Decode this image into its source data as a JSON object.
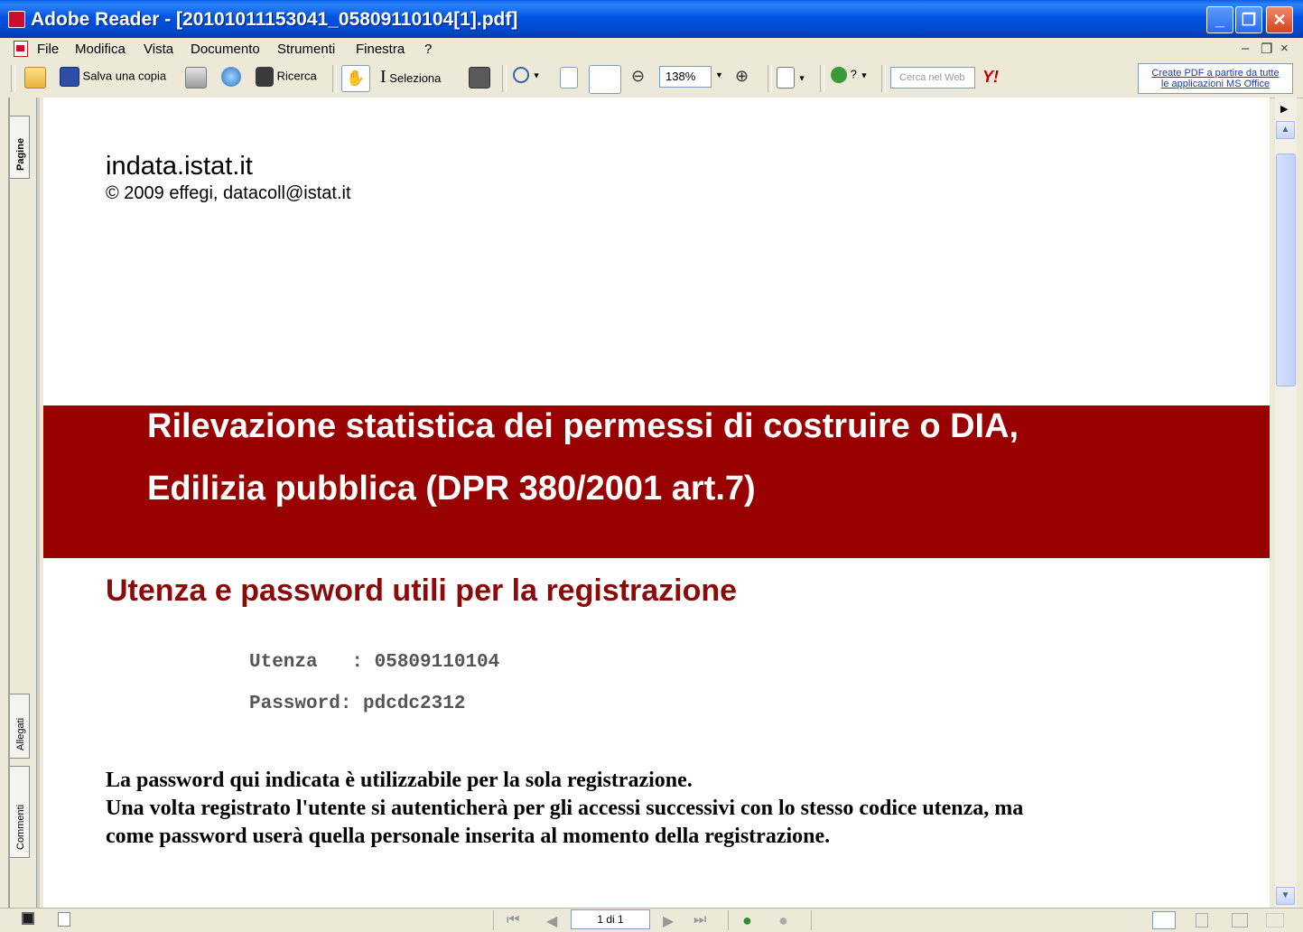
{
  "window": {
    "title": "Adobe Reader - [20101011153041_05809110104[1].pdf]",
    "controls": {
      "minimize": "_",
      "restore": "❐",
      "close": "✕"
    }
  },
  "menu": {
    "items": [
      "File",
      "Modifica",
      "Vista",
      "Documento",
      "Strumenti",
      "Finestra",
      "?"
    ],
    "mdi_controls": [
      "–",
      "❐",
      "×"
    ]
  },
  "toolbar": {
    "save_copy": "Salva una copia",
    "search": "Ricerca",
    "select": "Seleziona",
    "zoom": "138%",
    "help": "?",
    "web_search_placeholder": "Cerca nel Web",
    "yahoo": "Y!",
    "create_pdf_line1": "Create PDF a partire da tutte",
    "create_pdf_line2": "le applicazioni MS Office"
  },
  "side_tabs": {
    "pages": "Pagine",
    "attachments": "Allegati",
    "comments": "Commenti"
  },
  "document": {
    "site": "indata.istat.it",
    "copyright": "© 2009 effegi, datacoll@istat.it",
    "banner_line1": "Rilevazione statistica dei permessi di costruire o DIA,",
    "banner_line2": "Edilizia pubblica (DPR 380/2001 art.7)",
    "subheading": "Utenza e password utili per la registrazione",
    "user_line": "Utenza   : 05809110104",
    "password_line": "Password: pdcdc2312",
    "note_line1": "La password qui indicata è utilizzabile per la sola registrazione.",
    "note_line2": "Una volta registrato l'utente si autenticherà per gli accessi successivi con lo stesso codice utenza, ma",
    "note_line3": "come password userà quella personale inserita al momento della registrazione."
  },
  "status": {
    "page_indicator": "1 di 1"
  },
  "colors": {
    "banner": "#990000",
    "subheading": "#8B0A0A",
    "titlebar": "#0054E3"
  }
}
